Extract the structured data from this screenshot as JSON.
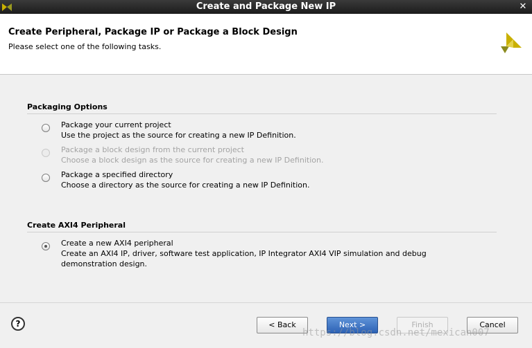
{
  "window": {
    "title": "Create and Package New IP",
    "close_glyph": "✕"
  },
  "header": {
    "title": "Create Peripheral, Package IP or Package a Block Design",
    "subtitle": "Please select one of the following tasks."
  },
  "packaging": {
    "section_title": "Packaging Options",
    "options": [
      {
        "label": "Package your current project",
        "description": "Use the project as the source for creating a new IP Definition.",
        "enabled": true,
        "selected": false
      },
      {
        "label": "Package a block design from the current project",
        "description": "Choose a block design as the source for creating a new IP Definition.",
        "enabled": false,
        "selected": false
      },
      {
        "label": "Package a specified directory",
        "description": "Choose a directory as the source for creating a new IP Definition.",
        "enabled": true,
        "selected": false
      }
    ]
  },
  "axi": {
    "section_title": "Create AXI4 Peripheral",
    "options": [
      {
        "label": "Create a new AXI4 peripheral",
        "description_line1": "Create an AXI4 IP, driver, software test application, IP Integrator AXI4 VIP simulation and debug",
        "description_line2": "demonstration design.",
        "enabled": true,
        "selected": true
      }
    ]
  },
  "footer": {
    "help_glyph": "?",
    "back_label": "< Back",
    "next_label": "Next >",
    "finish_label": "Finish",
    "cancel_label": "Cancel",
    "watermark": "https://blog.csdn.net/mexican007"
  },
  "colors": {
    "accent": "#2d62b5",
    "logo_yellow": "#c9b000",
    "logo_olive": "#8a8a1e"
  }
}
